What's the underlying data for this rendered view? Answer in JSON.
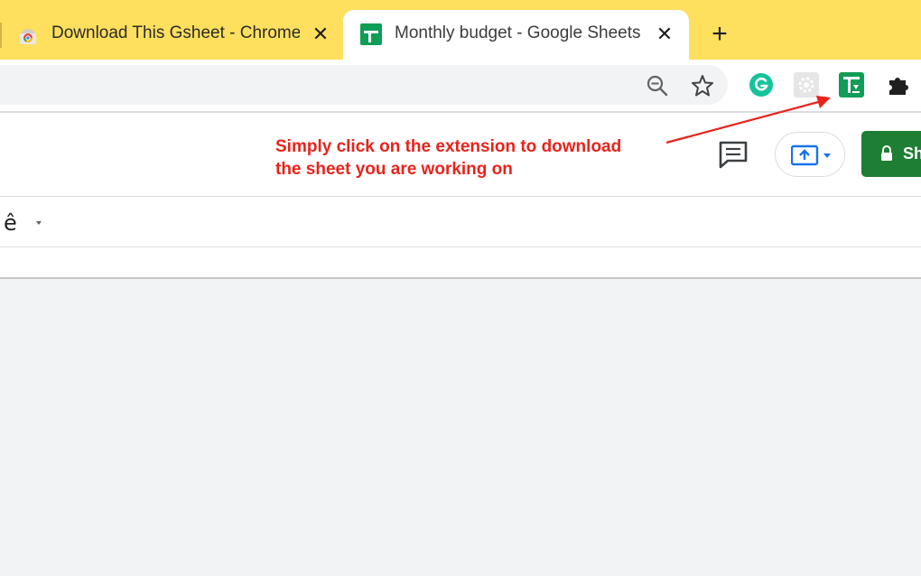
{
  "tabs": [
    {
      "title": "Download This Gsheet - Chrome Web Store",
      "favicon": "chrome-web-store-icon",
      "close": "✕"
    },
    {
      "title": "Monthly budget - Google Sheets",
      "favicon": "google-sheets-icon",
      "close": "✕",
      "active": true
    }
  ],
  "new_tab": "+",
  "toolbar": {
    "icons": [
      "zoom-out-icon",
      "star-icon"
    ],
    "extensions": [
      "grammarly-icon",
      "gear-extension-icon",
      "gsheet-download-extension-icon",
      "puzzle-icon"
    ]
  },
  "annotation": {
    "line1": "Simply click on the extension to download",
    "line2": "the sheet you are working on",
    "color": "#e8231b"
  },
  "sheet_header": {
    "share_label": "Sh",
    "comment_icon": "comment-icon",
    "present_icon": "present-icon"
  },
  "sheets_toolbar": {
    "font_glyph": "ê"
  },
  "colors": {
    "tabstrip": "#fedf5e",
    "share_button": "#1e7e34",
    "sheets_green": "#0f9d58"
  }
}
